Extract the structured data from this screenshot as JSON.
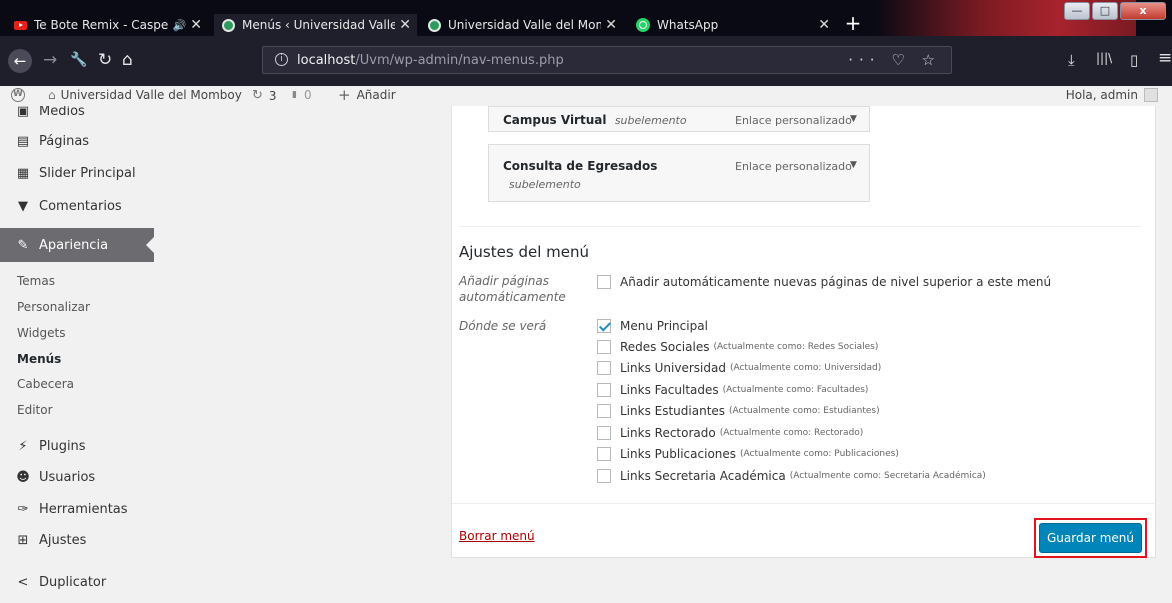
{
  "browser": {
    "tabs": [
      {
        "title": "Te Bote Remix - Casper, Nio",
        "audio_icon": "🔊",
        "favicon": "youtube-icon",
        "active": false
      },
      {
        "title": "Menús ‹ Universidad Valle del M",
        "favicon": "wordpress-icon",
        "active": true
      },
      {
        "title": "Universidad Valle del Momboy",
        "favicon": "wordpress-icon",
        "active": false
      },
      {
        "title": "WhatsApp",
        "favicon": "whatsapp-icon",
        "active": false
      }
    ],
    "tab_close": "✕",
    "new_tab": "+",
    "window_controls": {
      "minimize": "—",
      "maximize": "□",
      "close": "x"
    },
    "url_host": "localhost",
    "url_path": "/Uvm/wp-admin/nav-menus.php",
    "url_icon": "i",
    "url_actions": "··· ♡ ☆",
    "nav_icons": {
      "back": "←",
      "forward": "→",
      "tools": "🔧",
      "reload": "↻",
      "home": "⌂",
      "download": "⤓",
      "library": "|||\\",
      "sidebar": "▯",
      "menu": "≡"
    },
    "accent": "#a8232d"
  },
  "adminbar": {
    "logo": "W",
    "site_icon": "⌂",
    "site_name": "Universidad Valle del Momboy",
    "updates_icon": "↻",
    "updates_count": "3",
    "comments_icon": "▮",
    "comments_count": "0",
    "add_icon": "+",
    "add_label": "Añadir",
    "greeting": "Hola, admin"
  },
  "sidebar": {
    "items": [
      {
        "label": "Medios",
        "icon": "media-icon",
        "glyph": "▣"
      },
      {
        "label": "Páginas",
        "icon": "pages-icon",
        "glyph": "▤"
      },
      {
        "label": "Slider Principal",
        "icon": "slider-icon",
        "glyph": "▦"
      },
      {
        "label": "Comentarios",
        "icon": "comments-icon",
        "glyph": "▼"
      },
      {
        "label": "Apariencia",
        "icon": "appearance-icon",
        "glyph": "✎"
      },
      {
        "label": "Plugins",
        "icon": "plugins-icon",
        "glyph": "⚡"
      },
      {
        "label": "Usuarios",
        "icon": "users-icon",
        "glyph": "☻"
      },
      {
        "label": "Herramientas",
        "icon": "tools-icon",
        "glyph": "✑"
      },
      {
        "label": "Ajustes",
        "icon": "settings-icon",
        "glyph": "⊞"
      },
      {
        "label": "Duplicator",
        "icon": "duplicator-icon",
        "glyph": "<"
      }
    ],
    "submenu": [
      "Temas",
      "Personalizar",
      "Widgets",
      "Menús",
      "Cabecera",
      "Editor"
    ],
    "active_color": "#6b6b70"
  },
  "menu_items": [
    {
      "title": "Campus Virtual",
      "sub": "subelemento",
      "type": "Enlace personalizado",
      "arrow": "▼"
    },
    {
      "title": "Consulta de Egresados",
      "sub": "subelemento",
      "type": "Enlace personalizado",
      "arrow": "▼"
    }
  ],
  "settings": {
    "title": "Ajustes del menú",
    "auto_add_label": "Añadir páginas automáticamente",
    "auto_add_option": "Añadir automáticamente nuevas páginas de nivel superior a este menú",
    "locations_label": "Dónde se verá",
    "locations": [
      {
        "name": "Menu Principal",
        "note": "",
        "checked": true
      },
      {
        "name": "Redes Sociales",
        "note": "(Actualmente como: Redes Sociales)",
        "checked": false
      },
      {
        "name": "Links Universidad",
        "note": "(Actualmente como: Universidad)",
        "checked": false
      },
      {
        "name": "Links Facultades",
        "note": "(Actualmente como: Facultades)",
        "checked": false
      },
      {
        "name": "Links Estudiantes",
        "note": "(Actualmente como: Estudiantes)",
        "checked": false
      },
      {
        "name": "Links Rectorado",
        "note": "(Actualmente como: Rectorado)",
        "checked": false
      },
      {
        "name": "Links Publicaciones",
        "note": "(Actualmente como: Publicaciones)",
        "checked": false
      },
      {
        "name": "Links Secretaria Académica",
        "note": "(Actualmente como: Secretaria Académica)",
        "checked": false
      }
    ]
  },
  "footer": {
    "delete_label": "Borrar menú",
    "save_label": "Guardar menú",
    "save_color": "#0085ba",
    "highlight_color": "#e0141c"
  }
}
